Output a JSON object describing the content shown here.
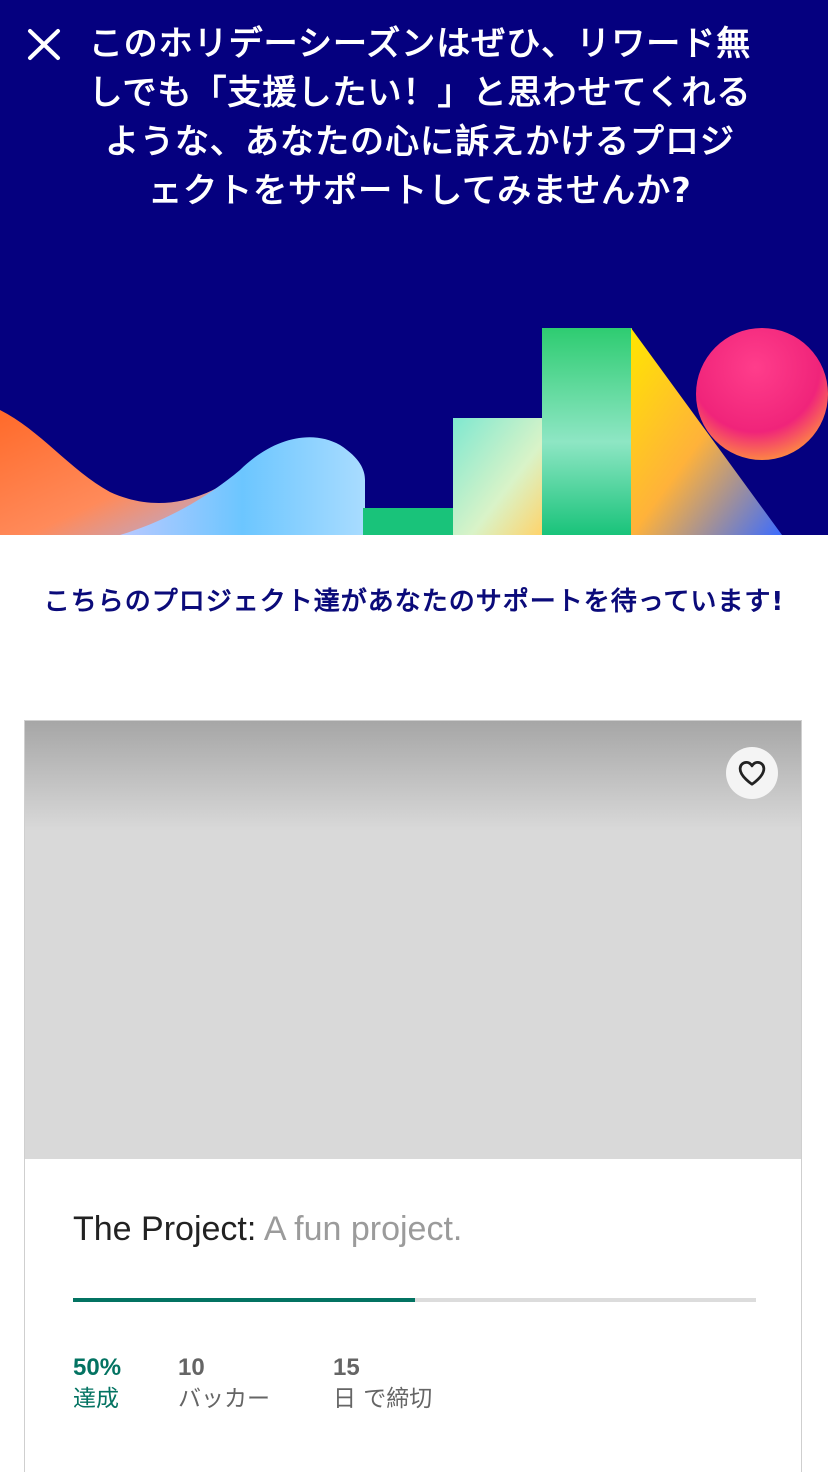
{
  "hero": {
    "title": "このホリデーシーズンはぜひ、リワード無しでも「支援したい！」と思わせてくれるような、あなたの心に訴えかけるプロジェクトをサポートしてみませんか?",
    "background_color": "#05007f",
    "close_icon": "close-icon"
  },
  "subtitle": "こちらのプロジェクト達があなたのサポートを待っています!",
  "project": {
    "name": "The Project:",
    "blurb": " A fun project.",
    "progress_fraction": 0.5,
    "favorite_icon": "heart-outline-icon",
    "stats": {
      "funded_value": "50%",
      "funded_label": "達成",
      "backers_value": "10",
      "backers_label": "バッカー",
      "days_value": "15",
      "days_label": "日 で締切"
    }
  },
  "colors": {
    "accent_green": "#037362",
    "subtitle_navy": "#0b0b7a",
    "hero_navy": "#05007f"
  }
}
